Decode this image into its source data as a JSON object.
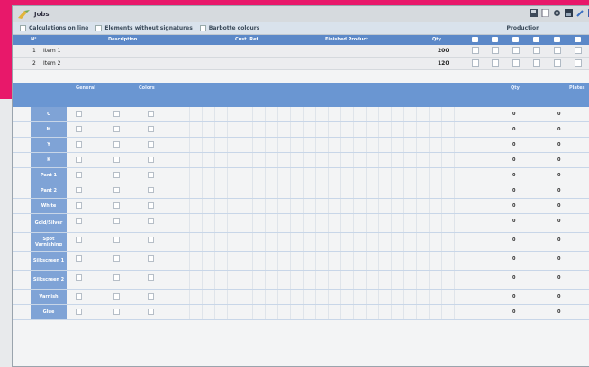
{
  "window": {
    "title": "Jobs"
  },
  "options": {
    "calc_label": "Calculations on line",
    "elements_label": "Elements without signatures",
    "barbe_label": "Barbotte colours"
  },
  "production_label": "Production",
  "products_table": {
    "headers": [
      "N°",
      "Description",
      "Cust. Ref.",
      "Finished Product",
      "Qty"
    ],
    "rows": [
      {
        "num": "1",
        "name": "Item 1",
        "qty": "200"
      },
      {
        "num": "2",
        "name": "Item 2",
        "qty": "120"
      }
    ]
  },
  "colors_table": {
    "header_general": "General",
    "header_colors": "Colors",
    "header_qty": "Qty",
    "header_plates": "Plates",
    "rows": [
      {
        "label": "C",
        "qty": "0",
        "plates": "0"
      },
      {
        "label": "M",
        "qty": "0",
        "plates": "0"
      },
      {
        "label": "Y",
        "qty": "0",
        "plates": "0"
      },
      {
        "label": "K",
        "qty": "0",
        "plates": "0"
      },
      {
        "label": "Pant 1",
        "qty": "0",
        "plates": "0"
      },
      {
        "label": "Pant 2",
        "qty": "0",
        "plates": "0"
      },
      {
        "label": "White",
        "qty": "0",
        "plates": "0"
      },
      {
        "label": "Gold/Silver",
        "qty": "0",
        "plates": "0"
      },
      {
        "label": "Spot Varnishing",
        "qty": "0",
        "plates": "0"
      },
      {
        "label": "Silkscreen 1",
        "qty": "0",
        "plates": "0"
      },
      {
        "label": "Silkscreen 2",
        "qty": "0",
        "plates": "0"
      },
      {
        "label": "Varnish",
        "qty": "0",
        "plates": "0"
      },
      {
        "label": "Glue",
        "qty": "0",
        "plates": "0"
      }
    ]
  },
  "colors": {
    "accent": "#e8186a",
    "header_blue": "#5b88c8",
    "row_label_blue": "#7fa3d6"
  }
}
